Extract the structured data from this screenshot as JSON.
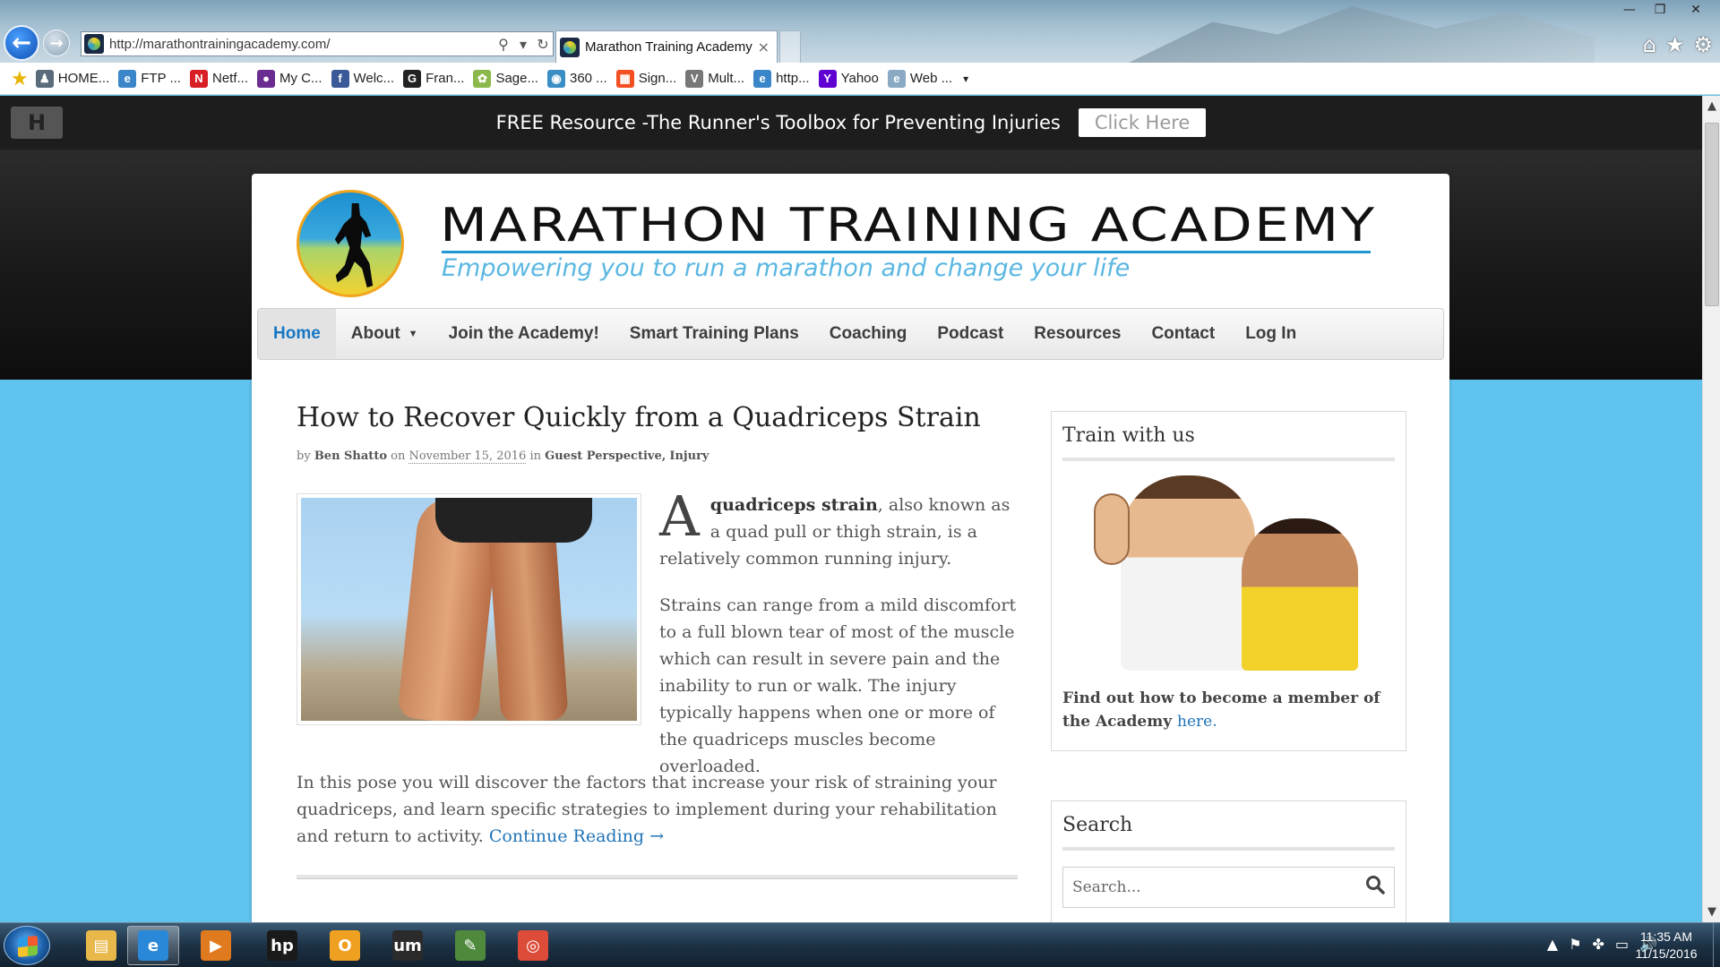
{
  "browser": {
    "url": "http://marathontrainingacademy.com/",
    "tab_title": "Marathon Training Academy",
    "tab_close": "×",
    "back_icon": "←",
    "forward_icon": "→",
    "search_icon": "⚲",
    "dropdown_icon": "▾",
    "refresh_icon": "↻",
    "window_minimize": "—",
    "window_restore": "❐",
    "window_close": "✕",
    "home_icon": "⌂",
    "favorites_icon": "★",
    "tools_icon": "⚙"
  },
  "favorites": [
    {
      "label": "HOME...",
      "icon_char": "♟",
      "color": "#5a6c7b"
    },
    {
      "label": "FTP ...",
      "icon_char": "e",
      "color": "#3a86c8"
    },
    {
      "label": "Netf...",
      "icon_char": "N",
      "color": "#d81f26"
    },
    {
      "label": "My C...",
      "icon_char": "●",
      "color": "#6b2c91"
    },
    {
      "label": "Welc...",
      "icon_char": "f",
      "color": "#3b5998"
    },
    {
      "label": "Fran...",
      "icon_char": "G",
      "color": "#222222"
    },
    {
      "label": "Sage...",
      "icon_char": "✿",
      "color": "#8bb84a"
    },
    {
      "label": "360 ...",
      "icon_char": "◉",
      "color": "#3a8ec4"
    },
    {
      "label": "Sign...",
      "icon_char": "▦",
      "color": "#f25022"
    },
    {
      "label": "Mult...",
      "icon_char": "V",
      "color": "#777777"
    },
    {
      "label": "http...",
      "icon_char": "e",
      "color": "#3a86c8"
    },
    {
      "label": "Yahoo",
      "icon_char": "Y",
      "color": "#5f01d1"
    },
    {
      "label": "Web ...",
      "icon_char": "e",
      "color": "#8aa9c4"
    }
  ],
  "favorites_more": "▾",
  "promo": {
    "logo": "H",
    "text": "FREE Resource -The Runner's Toolbox for Preventing Injuries",
    "button": "Click Here"
  },
  "site": {
    "title": "MARATHON TRAINING ACADEMY",
    "tagline": "Empowering you to run a marathon and change your life"
  },
  "nav": {
    "items": [
      {
        "label": "Home",
        "active": true
      },
      {
        "label": "About",
        "caret": "▼"
      },
      {
        "label": "Join the Academy!"
      },
      {
        "label": "Smart Training Plans"
      },
      {
        "label": "Coaching"
      },
      {
        "label": "Podcast"
      },
      {
        "label": "Resources"
      },
      {
        "label": "Contact"
      },
      {
        "label": "Log In"
      }
    ]
  },
  "article": {
    "title": "How to Recover Quickly from a Quadriceps Strain",
    "meta_by": "by",
    "author": "Ben Shatto",
    "meta_on": "on",
    "date": "November 15, 2016",
    "meta_in": "in",
    "category1": "Guest Perspective",
    "category_sep": ",",
    "category2": "Injury",
    "dropcap": "A",
    "intro_bold": "quadriceps strain",
    "intro_rest": ", also known as a quad pull or thigh strain, is a relatively common running injury.",
    "p2": "Strains can range from a mild discomfort to a full blown tear of most of the muscle which can result in severe pain and the inability to run or walk. The injury typically happens when one or more of the quadriceps muscles become overloaded.",
    "p3": "In this pose you will discover the factors that increase your risk of straining your quadriceps, and learn specific strategies to implement during your rehabilitation and return to activity.",
    "continue": "Continue Reading →"
  },
  "sidebar": {
    "train": {
      "title": "Train with us",
      "text": "Find out how to become a member of the Academy",
      "link": "here."
    },
    "search": {
      "title": "Search",
      "placeholder": "Search...",
      "icon": "🔍"
    }
  },
  "scrollbar": {
    "up": "▲",
    "down": "▼"
  },
  "taskbar": {
    "apps": [
      {
        "name": "file-explorer",
        "glyph": "▤",
        "color": "#e8b84a",
        "active": false
      },
      {
        "name": "internet-explorer",
        "glyph": "e",
        "color": "#2a88d8",
        "active": true
      },
      {
        "name": "media-player",
        "glyph": "▶",
        "color": "#e07a1f",
        "active": false
      },
      {
        "name": "hp",
        "glyph": "hp",
        "color": "#1a1a1a",
        "active": false
      },
      {
        "name": "outlook",
        "glyph": "O",
        "color": "#f0a020",
        "active": false
      },
      {
        "name": "um-app",
        "glyph": "um",
        "color": "#2b2b2b",
        "active": false
      },
      {
        "name": "evernote",
        "glyph": "✎",
        "color": "#4f8a3c",
        "active": false
      },
      {
        "name": "chrome",
        "glyph": "◎",
        "color": "#dd4b39",
        "active": false
      }
    ],
    "tray_icons": [
      "▲",
      "⚑",
      "✤",
      "▭",
      "🔊"
    ],
    "time": "11:35 AM",
    "date": "11/15/2016"
  }
}
